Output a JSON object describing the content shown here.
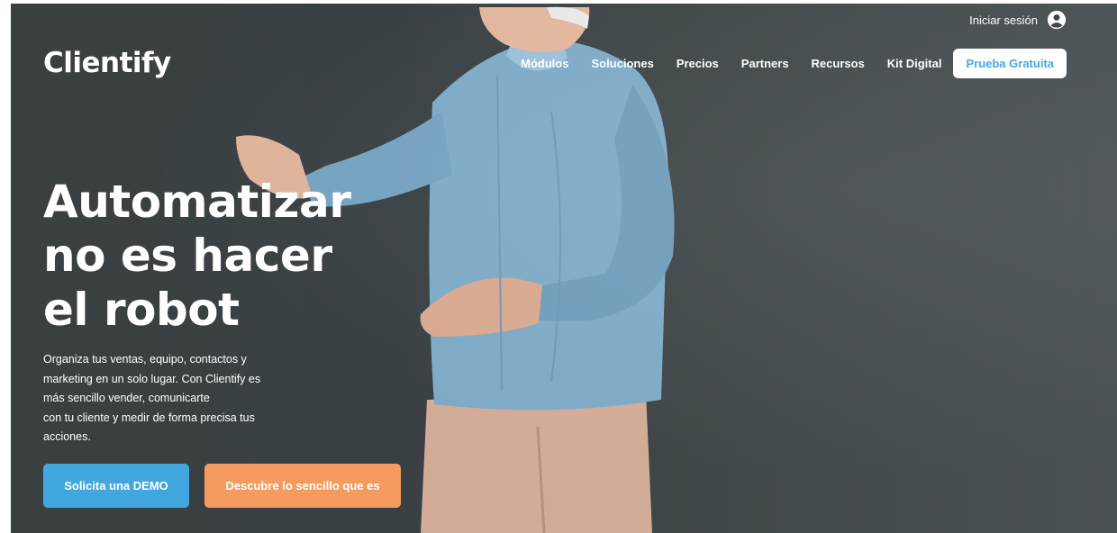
{
  "brand": {
    "logo_text": "Clientify"
  },
  "header": {
    "login_label": "Iniciar sesión",
    "login_icon": "user-circle-icon"
  },
  "nav": {
    "items": [
      "Módulos",
      "Soluciones",
      "Precios",
      "Partners",
      "Recursos",
      "Kit Digital"
    ],
    "cta_label": "Prueba Gratuita"
  },
  "hero": {
    "headline_lines": [
      "Automatizar",
      "no es hacer",
      "el robot"
    ],
    "subtitle_lines": [
      "Organiza tus ventas, equipo, contactos y",
      "marketing en un solo lugar. Con Clientify es",
      "más sencillo vender, comunicarte",
      "con tu cliente y medir de forma precisa tus",
      "acciones."
    ],
    "primary_button": "Solicita una DEMO",
    "secondary_button": "Descubre lo sencillo que es"
  },
  "colors": {
    "background": "#3a4042",
    "accent_blue": "#43a7df",
    "accent_orange": "#f59b5f",
    "text": "#ffffff"
  }
}
